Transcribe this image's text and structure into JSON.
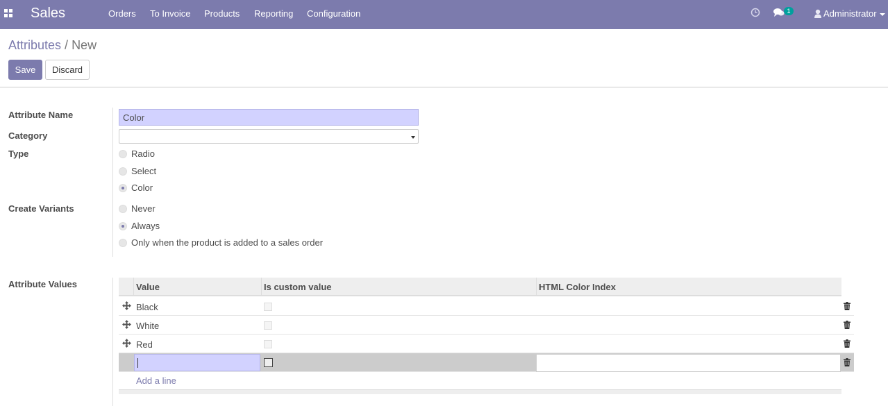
{
  "navbar": {
    "brand": "Sales",
    "menu": [
      "Orders",
      "To Invoice",
      "Products",
      "Reporting",
      "Configuration"
    ],
    "messages_count": "1",
    "user": "Administrator"
  },
  "breadcrumb": {
    "parent": "Attributes",
    "separator": "/",
    "current": "New"
  },
  "buttons": {
    "save": "Save",
    "discard": "Discard"
  },
  "form": {
    "attribute_name_label": "Attribute Name",
    "attribute_name_value": "Color",
    "category_label": "Category",
    "category_value": "",
    "type_label": "Type",
    "type_options": [
      "Radio",
      "Select",
      "Color"
    ],
    "type_selected": "Color",
    "create_variants_label": "Create Variants",
    "create_variants_options": [
      "Never",
      "Always",
      "Only when the product is added to a sales order"
    ],
    "create_variants_selected": "Always",
    "attribute_values_label": "Attribute Values"
  },
  "values_table": {
    "columns": [
      "Value",
      "Is custom value",
      "HTML Color Index"
    ],
    "rows": [
      {
        "value": "Black",
        "is_custom": false
      },
      {
        "value": "White",
        "is_custom": false
      },
      {
        "value": "Red",
        "is_custom": false
      }
    ],
    "add_line": "Add a line"
  },
  "colors": {
    "brand": "#7c7bad",
    "badge": "#00a09d",
    "input_focus": "#d2d2ff"
  },
  "icons": [
    "apps-icon",
    "clock-icon",
    "chat-icon",
    "user-icon",
    "drag-handle-icon",
    "trash-icon"
  ]
}
